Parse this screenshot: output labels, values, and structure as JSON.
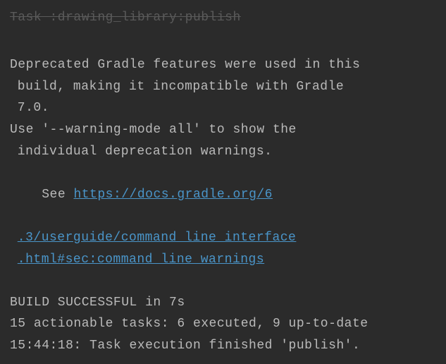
{
  "console": {
    "truncated_top": "Task :drawing_library:publish",
    "deprecation_line1": "Deprecated Gradle features were used in this",
    "deprecation_line2": "build, making it incompatible with Gradle",
    "deprecation_line3": "7.0.",
    "warning_line1": "Use '--warning-mode all' to show the",
    "warning_line2": "individual deprecation warnings.",
    "see_prefix": "See ",
    "link_part1": "https://docs.gradle.org/6",
    "link_part2": ".3/userguide/command_line_interface",
    "link_part3": ".html#sec:command_line_warnings",
    "build_status": "BUILD SUCCESSFUL in 7s",
    "tasks_summary": "15 actionable tasks: 6 executed, 9 up-to-date",
    "finished_line": "15:44:18: Task execution finished 'publish'."
  }
}
